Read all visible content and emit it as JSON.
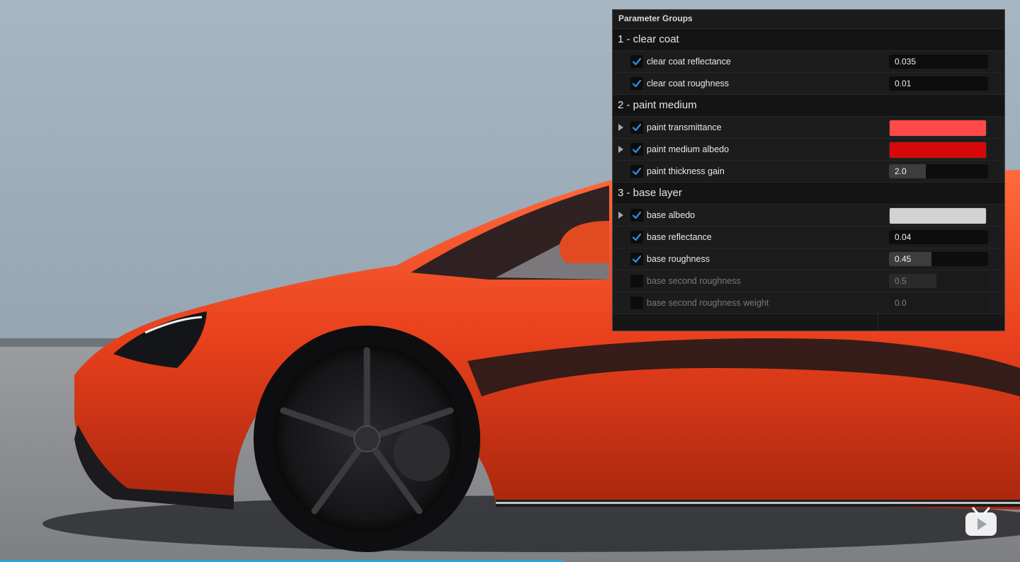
{
  "panel": {
    "title": "Parameter Groups",
    "groups": [
      {
        "title": "1 - clear coat",
        "params": [
          {
            "label": "clear coat reflectance",
            "enabled": true,
            "expandable": false,
            "type": "number",
            "value": "0.035",
            "slider_fraction": 0
          },
          {
            "label": "clear coat roughness",
            "enabled": true,
            "expandable": false,
            "type": "number",
            "value": "0.01",
            "slider_fraction": 0
          }
        ]
      },
      {
        "title": "2 - paint medium",
        "params": [
          {
            "label": "paint transmittance",
            "enabled": true,
            "expandable": true,
            "type": "color",
            "color": "#ff4a4a"
          },
          {
            "label": "paint medium albedo",
            "enabled": true,
            "expandable": true,
            "type": "color",
            "color": "#d60808"
          },
          {
            "label": "paint thickness gain",
            "enabled": true,
            "expandable": false,
            "type": "number",
            "value": "2.0",
            "slider_fraction": 0.37
          }
        ]
      },
      {
        "title": "3 - base layer",
        "params": [
          {
            "label": "base albedo",
            "enabled": true,
            "expandable": true,
            "type": "color",
            "color": "#d2d2d2"
          },
          {
            "label": "base reflectance",
            "enabled": true,
            "expandable": false,
            "type": "number",
            "value": "0.04",
            "slider_fraction": 0
          },
          {
            "label": "base roughness",
            "enabled": true,
            "expandable": false,
            "type": "number",
            "value": "0.45",
            "slider_fraction": 0.43
          },
          {
            "label": "base second roughness",
            "enabled": false,
            "expandable": false,
            "type": "number",
            "value": "0.5",
            "slider_fraction": 0.48
          },
          {
            "label": "base second roughness weight",
            "enabled": false,
            "expandable": false,
            "type": "number",
            "value": "0.0",
            "slider_fraction": 0
          }
        ]
      }
    ]
  },
  "colors": {
    "checkbox_check": "#2f8ff0",
    "car_paint": "#e8401c",
    "wall": "#9eb0be",
    "ground": "#8f9094"
  },
  "badge": {
    "icon": "tv-play-icon"
  }
}
